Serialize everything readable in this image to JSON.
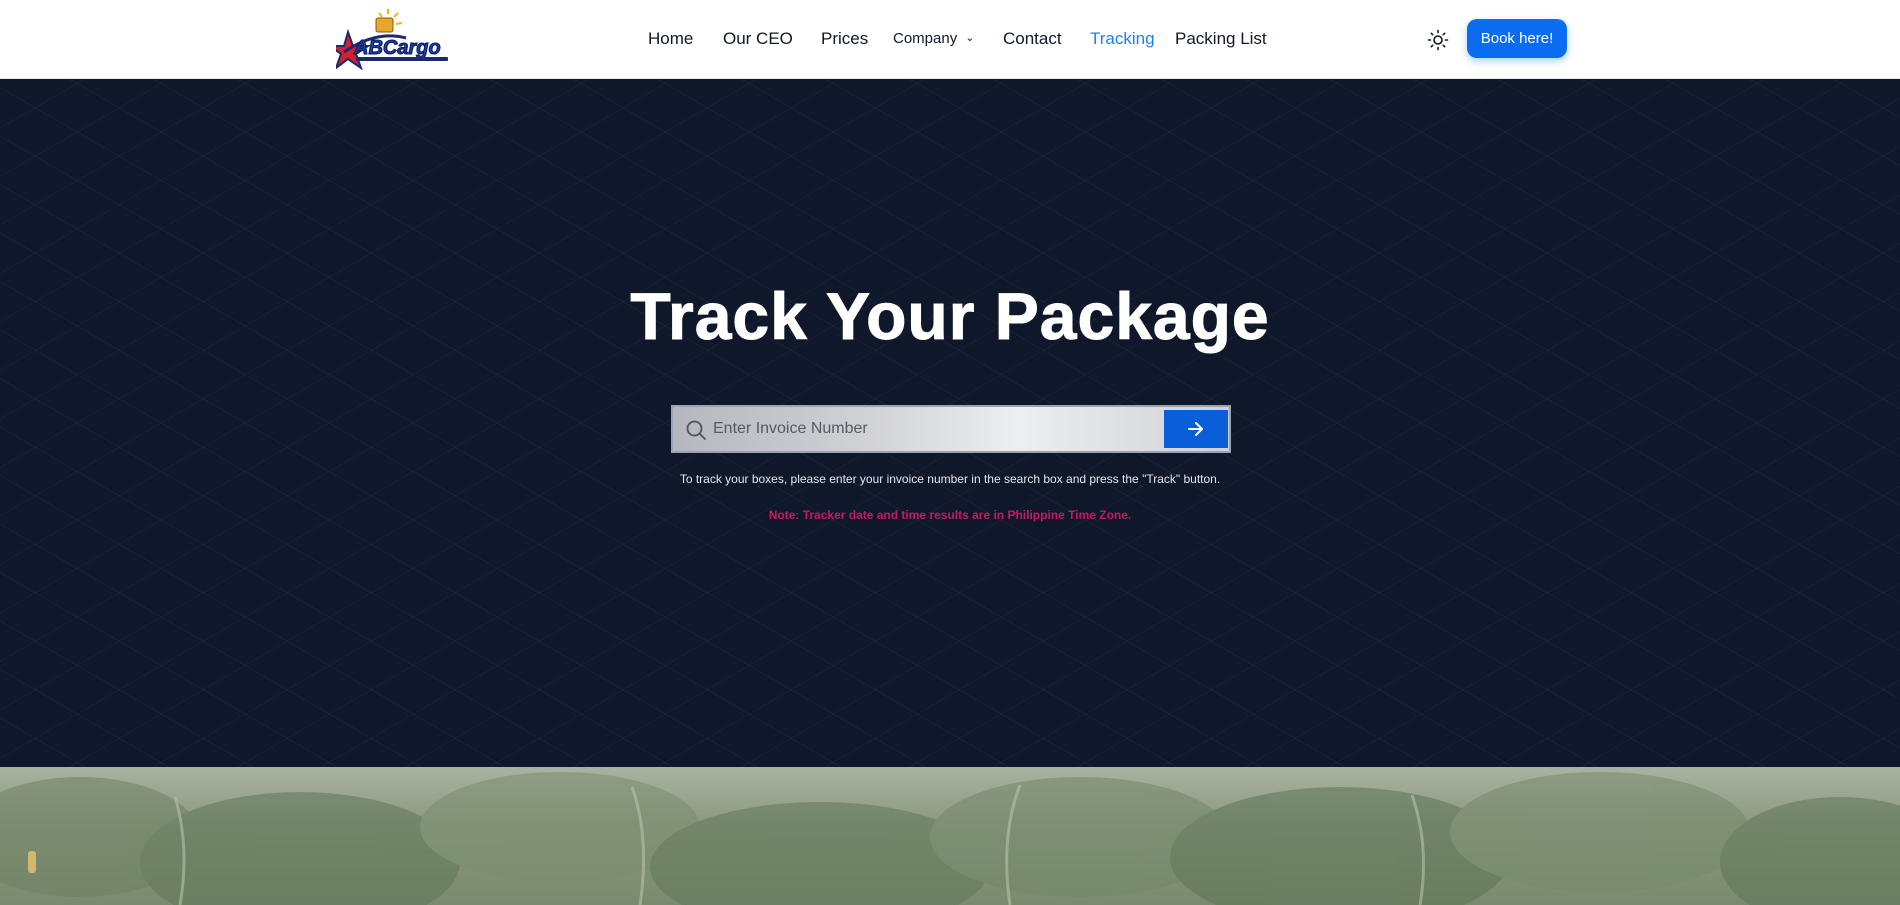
{
  "header": {
    "logo_text": "ABCargo",
    "nav": [
      {
        "label": "Home"
      },
      {
        "label": "Our CEO"
      },
      {
        "label": "Prices"
      },
      {
        "label": "Company"
      },
      {
        "label": "Contact"
      },
      {
        "label": "Tracking",
        "active": true
      },
      {
        "label": "Packing List"
      }
    ],
    "book_label": "Book here!"
  },
  "hero": {
    "title": "Track Your Package",
    "search_placeholder": "Enter Invoice Number",
    "helper_text": "To track your boxes, please enter your invoice number in the search box and press the \"Track\" button.",
    "note_text": "Note: Tracker date and time results are in Philippine Time Zone."
  },
  "icons": {
    "theme": "sun-icon",
    "search": "search-icon",
    "submit": "arrow-right-icon",
    "dropdown": "chevron-down-icon"
  },
  "colors": {
    "accent": "#0a6cf1",
    "active_nav": "#1d7ff2",
    "hero_bg": "#0f172a",
    "note": "#c9195f"
  }
}
